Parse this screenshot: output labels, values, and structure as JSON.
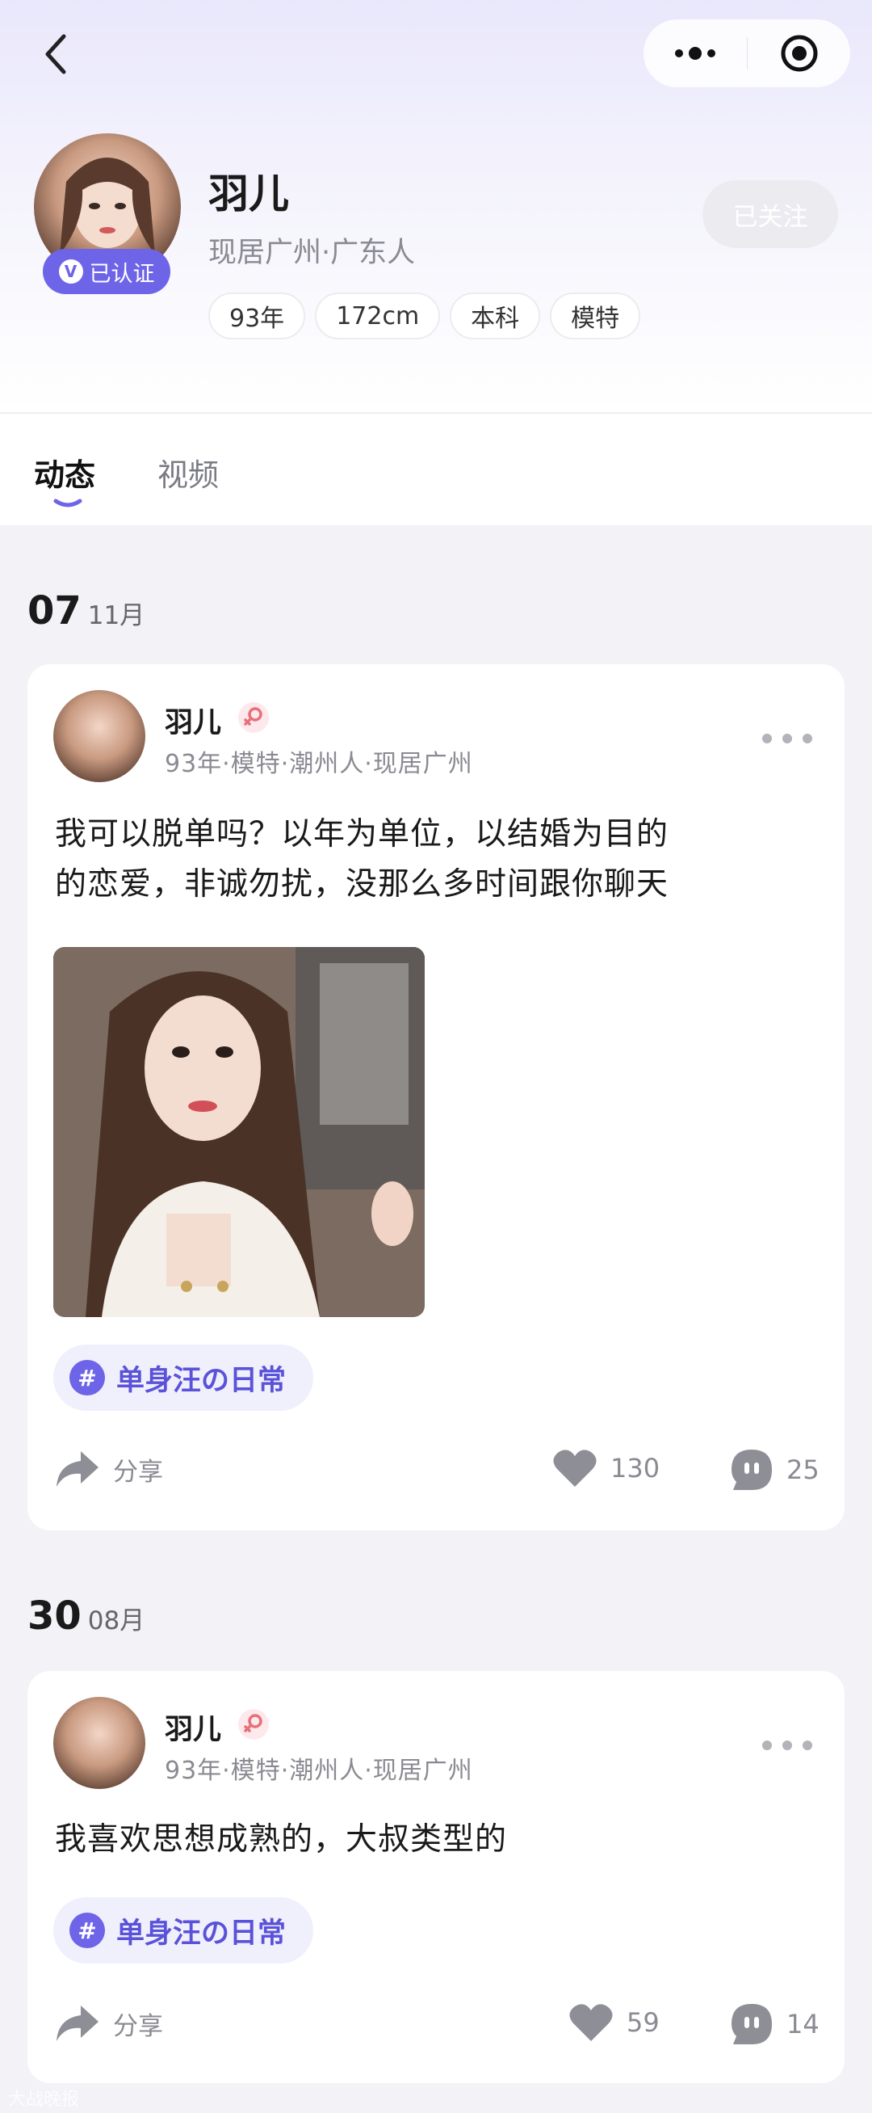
{
  "profile": {
    "name": "羽儿",
    "location": "现居广州·广东人",
    "verified_label": "已认证",
    "tags": [
      "93年",
      "172cm",
      "本科",
      "模特"
    ],
    "follow_label": "已关注"
  },
  "tabs": [
    {
      "label": "动态",
      "active": true
    },
    {
      "label": "视频",
      "active": false
    }
  ],
  "posts": [
    {
      "date_day": "07",
      "date_month": "11月",
      "author": "羽儿",
      "meta": "93年·模特·潮州人·现居广州",
      "text_lines": [
        "我可以脱单吗？以年为单位，以结婚为目的",
        "的恋爱，非诚勿扰，没那么多时间跟你聊天"
      ],
      "topic": "单身汪の日常",
      "share_label": "分享",
      "likes": "130",
      "comments": "25"
    },
    {
      "date_day": "30",
      "date_month": "08月",
      "author": "羽儿",
      "meta": "93年·模特·潮州人·现居广州",
      "text_lines": [
        "我喜欢思想成熟的，大叔类型的"
      ],
      "topic": "单身汪の日常",
      "share_label": "分享",
      "likes": "59",
      "comments": "14"
    }
  ],
  "watermark": "大战晚报",
  "colors": {
    "accent": "#6e64e8",
    "topic_bg": "#f0effc",
    "page_bg": "#f2f2f7",
    "gender_icon": "#e8707a"
  },
  "icons": {
    "back": "chevron-left-icon",
    "more": "more-icon",
    "target": "target-icon",
    "share": "share-icon",
    "like": "heart-icon",
    "comment": "comment-icon",
    "gender": "female-icon",
    "verify": "verified-v-icon",
    "topic": "hashtag-icon"
  }
}
